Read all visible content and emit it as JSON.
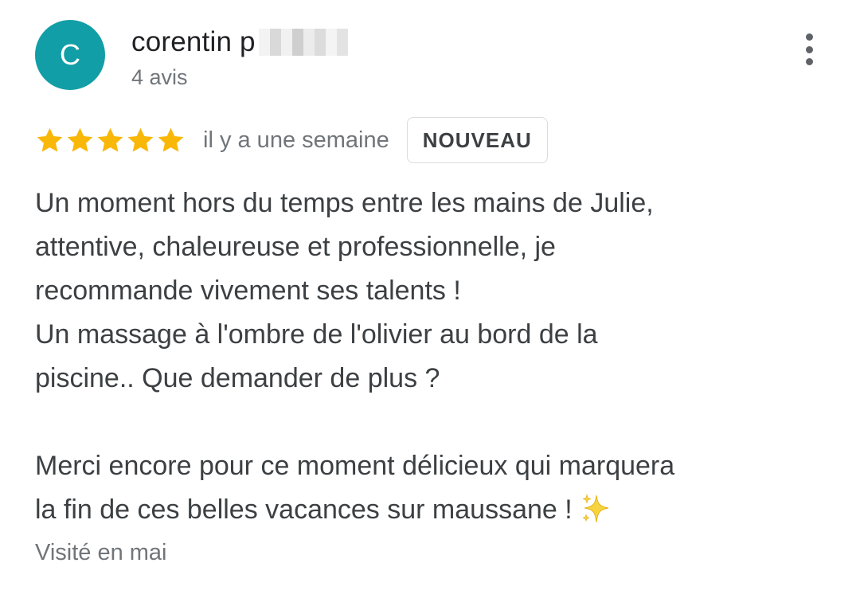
{
  "reviewer": {
    "avatar_letter": "C",
    "name": "corentin p",
    "review_count": "4 avis",
    "avatar_color": "#129ea6"
  },
  "review": {
    "rating": 5,
    "max_rating": 5,
    "date": "il y a une semaine",
    "badge": "NOUVEAU",
    "lines": [
      "Un moment hors du temps entre les mains de Julie,",
      "attentive, chaleureuse et professionnelle, je",
      "recommande vivement ses talents !",
      "Un massage à l'ombre de l'olivier au bord de la",
      "piscine.. Que demander de plus ?",
      "",
      "Merci encore pour ce moment délicieux qui marquera",
      "la fin de ces belles vacances sur maussane !"
    ],
    "emoji": "sparkles-icon",
    "visited": "Visité en mai"
  },
  "colors": {
    "star": "#f9b707",
    "text_primary": "#202124",
    "text_secondary": "#70757a"
  },
  "icons": {
    "menu": "more-vertical-icon",
    "star": "star-icon"
  }
}
